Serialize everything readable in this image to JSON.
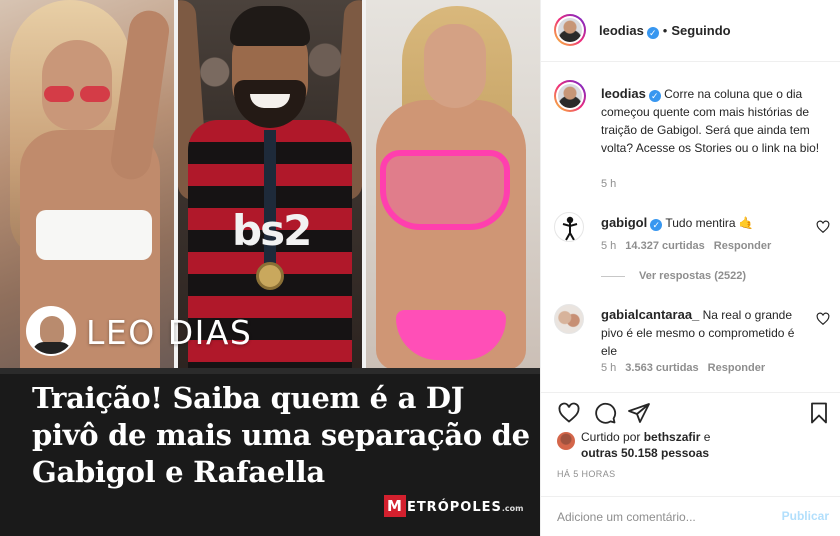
{
  "post": {
    "image": {
      "overlay_name": "LEO DIAS",
      "shirt_text": "bs2",
      "headline": "Traição! Saiba quem é a DJ pivô de mais uma separação de Gabigol e Rafaella",
      "brand_initial": "M",
      "brand_rest": "ETRÓPOLES",
      "brand_suffix": ".com"
    }
  },
  "header": {
    "username": "leodias",
    "verified_mark": "✓",
    "separator": "•",
    "follow_status": "Seguindo"
  },
  "caption": {
    "username": "leodias",
    "text": "Corre na coluna que o dia começou quente com mais histórias de traição de Gabigol. Será que ainda tem volta? Acesse os Stories ou o link na bio!",
    "time": "5 h"
  },
  "comments": [
    {
      "username": "gabigol",
      "text": "Tudo mentira 🤙",
      "time": "5 h",
      "likes": "14.327 curtidas",
      "reply": "Responder"
    },
    {
      "username": "gabialcantaraa_",
      "text": "Na real o grande pivo é ele mesmo o comprometido é ele",
      "time": "5 h",
      "likes": "3.563 curtidas",
      "reply": "Responder"
    }
  ],
  "view_replies": "Ver respostas (2522)",
  "likes": {
    "prefix": "Curtido por",
    "first_user": "bethszafir",
    "connector": "e",
    "others": "outras 50.158 pessoas"
  },
  "timestamp": "HÁ 5 HORAS",
  "comment_box": {
    "placeholder": "Adicione um comentário...",
    "post_label": "Publicar"
  },
  "colors": {
    "accent_blue": "#3897f0",
    "post_button_disabled": "#b2dffc",
    "muted_text": "#8e8e8e",
    "brand_red": "#d3202e"
  }
}
